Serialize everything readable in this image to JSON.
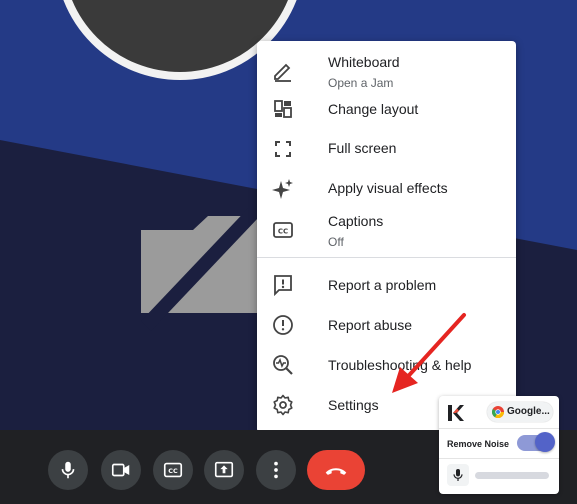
{
  "background": {
    "colors": {
      "blue": "#243a86",
      "dark": "#1b1f3f",
      "avatar_ring": "#f2f2f2"
    },
    "center_icon": "camera-off-icon"
  },
  "menu": {
    "items": [
      {
        "id": "whiteboard",
        "label": "Whiteboard",
        "sublabel": "Open a Jam",
        "icon": "pencil-icon"
      },
      {
        "id": "change-layout",
        "label": "Change layout",
        "icon": "layout-icon"
      },
      {
        "id": "full-screen",
        "label": "Full screen",
        "icon": "fullscreen-icon"
      },
      {
        "id": "visual-effects",
        "label": "Apply visual effects",
        "icon": "sparkle-icon"
      },
      {
        "id": "captions",
        "label": "Captions",
        "sublabel": "Off",
        "icon": "cc-icon"
      },
      {
        "id": "report-problem",
        "label": "Report a problem",
        "icon": "feedback-icon"
      },
      {
        "id": "report-abuse",
        "label": "Report abuse",
        "icon": "alert-circle-icon"
      },
      {
        "id": "troubleshooting",
        "label": "Troubleshooting & help",
        "icon": "troubleshoot-icon"
      },
      {
        "id": "settings",
        "label": "Settings",
        "icon": "gear-icon"
      }
    ]
  },
  "toolbar": {
    "buttons": [
      {
        "id": "mic",
        "icon": "microphone-icon"
      },
      {
        "id": "camera",
        "icon": "video-camera-icon"
      },
      {
        "id": "captions",
        "icon": "cc-icon"
      },
      {
        "id": "present",
        "icon": "present-screen-icon"
      },
      {
        "id": "more",
        "icon": "more-vertical-icon"
      },
      {
        "id": "end-call",
        "icon": "hang-up-icon"
      }
    ],
    "colors": {
      "button_bg": "#3c4043",
      "end_call": "#ea4335",
      "bar": "#202124"
    }
  },
  "annotation": {
    "arrow_color": "#e52521",
    "points_to": "settings"
  },
  "krisp": {
    "logo": "krisp-logo-icon",
    "source_label": "Google...",
    "source_icon": "chrome-icon",
    "remove_noise_label": "Remove Noise",
    "remove_noise_on": true,
    "mic_icon": "microphone-icon",
    "accent": "#5363c8"
  }
}
